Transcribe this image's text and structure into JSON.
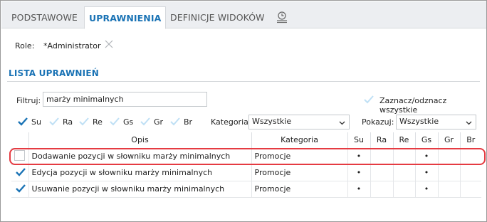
{
  "tabs": [
    {
      "label": "PODSTAWOWE",
      "active": false
    },
    {
      "label": "UPRAWNIENIA",
      "active": true
    },
    {
      "label": "DEFINICJE WIDOKÓW",
      "active": false
    }
  ],
  "tab_icon": "history-list-icon",
  "role": {
    "label": "Role:",
    "value": "*Administrator"
  },
  "section_title": "LISTA UPRAWNIEŃ",
  "filter": {
    "label": "Filtruj:",
    "value": "marży minimalnych"
  },
  "toggle_all": {
    "label": "Zaznacz/odznacz wszystkie",
    "checked": false
  },
  "perm_filters": [
    {
      "label": "Su",
      "checked": true
    },
    {
      "label": "Ra",
      "checked": false
    },
    {
      "label": "Re",
      "checked": false
    },
    {
      "label": "Gs",
      "checked": false
    },
    {
      "label": "Gr",
      "checked": false
    },
    {
      "label": "Br",
      "checked": false
    }
  ],
  "category_filter": {
    "label": "Kategoria:",
    "value": "Wszystkie"
  },
  "show_filter": {
    "label": "Pokazuj:",
    "value": "Wszystkie"
  },
  "table": {
    "columns": [
      "",
      "Opis",
      "Kategoria",
      "Su",
      "Ra",
      "Re",
      "Gs",
      "Gr",
      "Br"
    ],
    "rows": [
      {
        "checked": false,
        "opis": "Dodawanie pozycji w słowniku marży minimalnych",
        "kategoria": "Promocje",
        "su": "•",
        "ra": "",
        "re": "",
        "gs": "•",
        "gr": "",
        "br": ""
      },
      {
        "checked": true,
        "opis": "Edycja pozycji w słowniku marży minimalnych",
        "kategoria": "Promocje",
        "su": "•",
        "ra": "",
        "re": "",
        "gs": "•",
        "gr": "",
        "br": ""
      },
      {
        "checked": true,
        "opis": "Usuwanie pozycji w słowniku marży minimalnych",
        "kategoria": "Promocje",
        "su": "•",
        "ra": "",
        "re": "",
        "gs": "•",
        "gr": "",
        "br": ""
      }
    ]
  },
  "colors": {
    "accent": "#1a73b5",
    "highlight": "#e53b42",
    "check": "#1a73b5",
    "check_faded": "#bfe0f5"
  }
}
